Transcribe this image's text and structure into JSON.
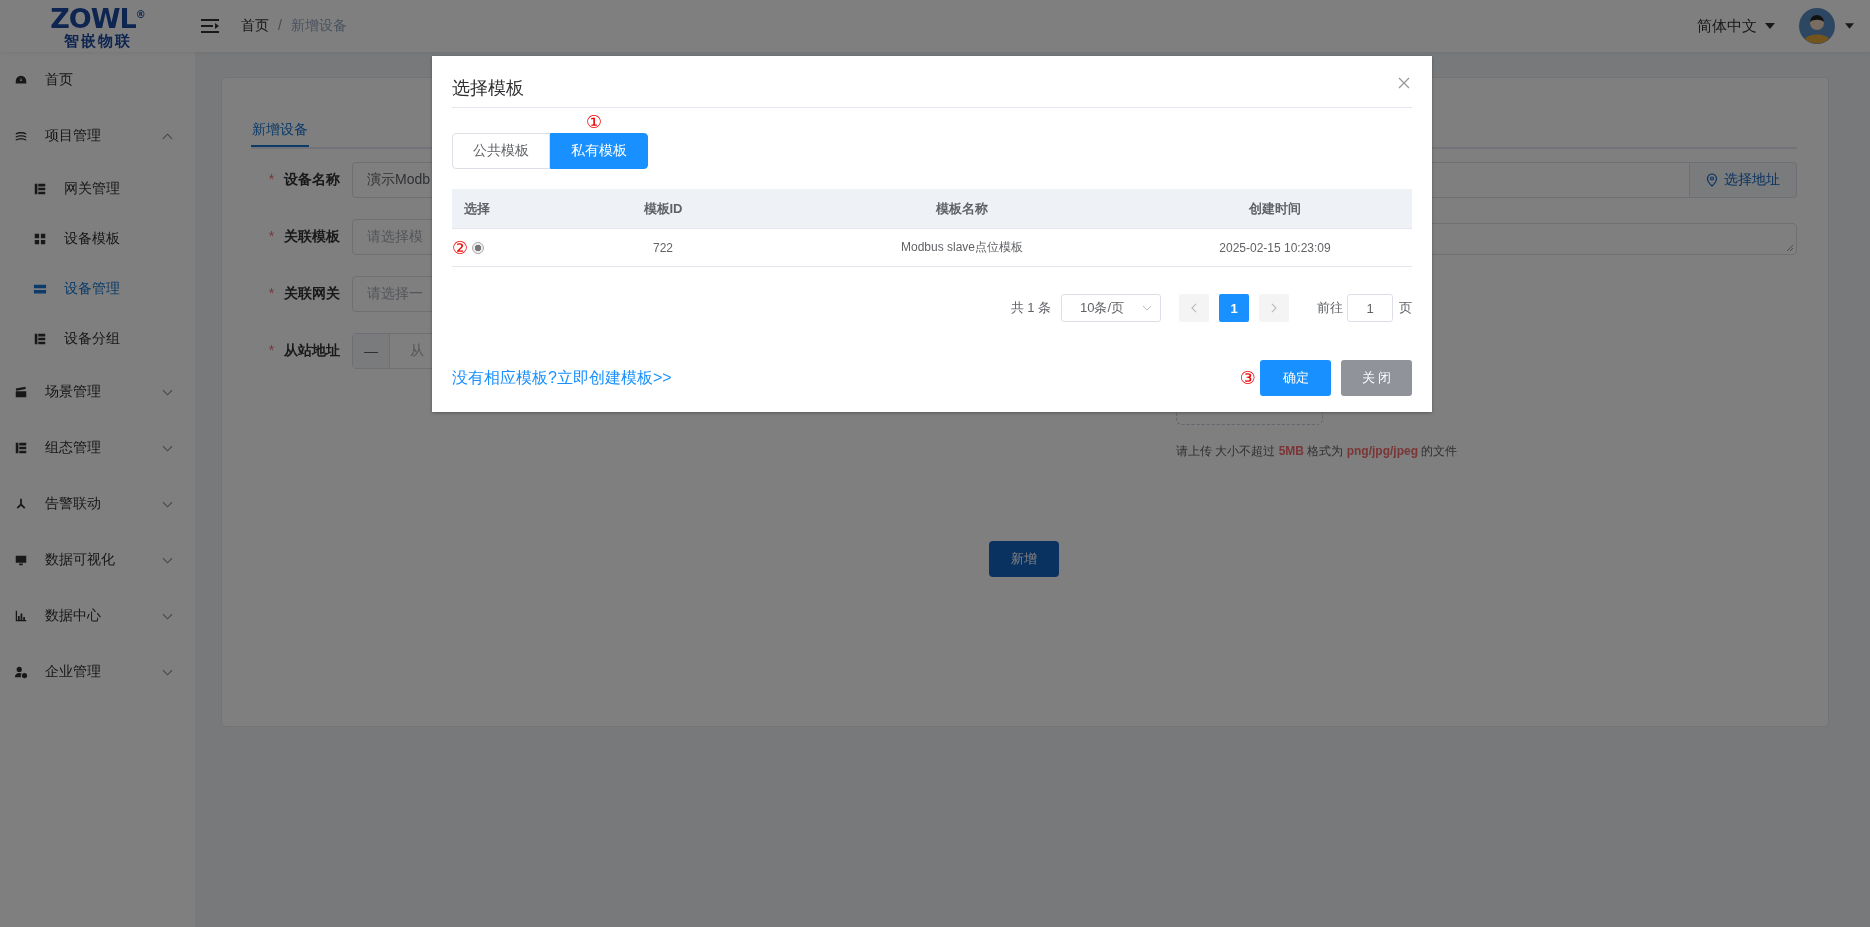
{
  "header": {
    "logo": {
      "name": "ZOWL",
      "mark": "®",
      "subtitle": "智嵌物联"
    },
    "breadcrumb": [
      {
        "label": "首页",
        "current": false
      },
      {
        "label": "新增设备",
        "current": true
      }
    ],
    "separator": "/",
    "language": "简体中文"
  },
  "sidebar": {
    "items": [
      {
        "label": "首页",
        "selected": false
      },
      {
        "label": "项目管理",
        "selected": false,
        "expanded": true,
        "children": [
          {
            "label": "网关管理",
            "selected": false
          },
          {
            "label": "设备模板",
            "selected": false
          },
          {
            "label": "设备管理",
            "selected": true
          },
          {
            "label": "设备分组",
            "selected": false
          }
        ]
      },
      {
        "label": "场景管理",
        "selected": false,
        "expanded": false
      },
      {
        "label": "组态管理",
        "selected": false,
        "expanded": false
      },
      {
        "label": "告警联动",
        "selected": false,
        "expanded": false
      },
      {
        "label": "数据可视化",
        "selected": false,
        "expanded": false
      },
      {
        "label": "数据中心",
        "selected": false,
        "expanded": false
      },
      {
        "label": "企业管理",
        "selected": false,
        "expanded": false
      }
    ]
  },
  "page": {
    "tabs": [
      {
        "label": "新增设备",
        "selected": true
      }
    ],
    "required_mark": "*",
    "fields": [
      {
        "label": "设备名称",
        "required": true,
        "kind": "text",
        "value": "演示Modb"
      },
      {
        "label": "关联模板",
        "required": true,
        "kind": "select",
        "placeholder": "请选择模"
      },
      {
        "label": "关联网关",
        "required": true,
        "kind": "select",
        "placeholder": "请选择一"
      },
      {
        "label": "从站地址",
        "required": true,
        "kind": "stepper",
        "decrement": "—",
        "placeholder": "从"
      }
    ],
    "address_button": "选择地址",
    "upload_hint": "请上传 大小不超过 **5MB** 格式为 **png/jpg/jpeg** 的文件",
    "submit": "新增"
  },
  "modal": {
    "title": "选择模板",
    "tabs": [
      {
        "label": "公共模板",
        "selected": false
      },
      {
        "label": "私有模板",
        "selected": true
      }
    ],
    "tab_marker": "①",
    "table": {
      "columns": [
        "选择",
        "模板ID",
        "模板名称",
        "创建时间"
      ],
      "rows": [
        {
          "selected": true,
          "marker": "②",
          "id": "722",
          "name": "Modbus slave点位模板",
          "created": "2025-02-15 10:23:09"
        }
      ]
    },
    "pagination": {
      "total": "共 1 条",
      "page_size": "10条/页",
      "pages": [
        {
          "label": "1",
          "selected": true
        }
      ],
      "goto_label": "前往",
      "goto_value": "1",
      "goto_suffix": "页"
    },
    "create_link": "没有相应模板?立即创建模板>>",
    "confirm_marker": "③",
    "buttons": [
      {
        "label": "确定",
        "kind": "primary"
      },
      {
        "label": "关 闭",
        "kind": "secondary"
      }
    ]
  }
}
